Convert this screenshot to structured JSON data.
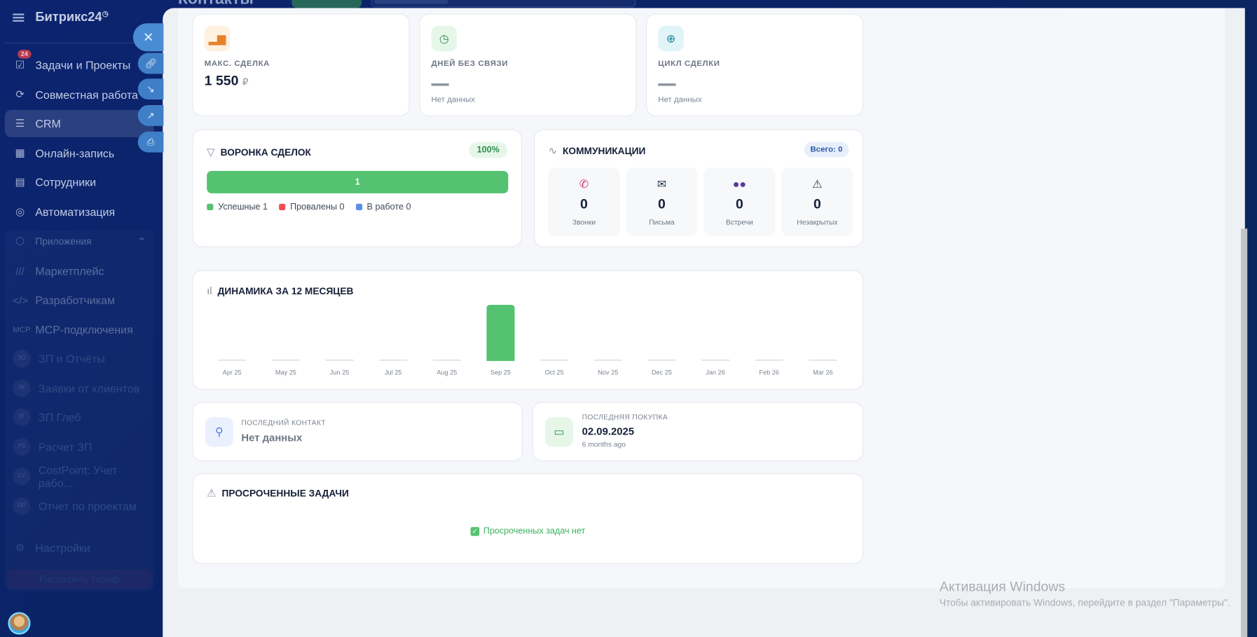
{
  "topbar": {
    "title": "Контакты"
  },
  "sidebar": {
    "logo": "Битрикс24",
    "items": [
      {
        "label": "Задачи и Проекты",
        "badge": "24"
      },
      {
        "label": "Совместная работа"
      },
      {
        "label": "CRM"
      },
      {
        "label": "Онлайн-запись"
      },
      {
        "label": "Сотрудники"
      },
      {
        "label": "Автоматизация"
      }
    ],
    "group": {
      "label": "Приложения",
      "items": [
        {
          "label": "Маркетплейс",
          "icon": "MI"
        },
        {
          "label": "Разработчикам",
          "icon": "</>"
        },
        {
          "label": "MCP-подключения",
          "icon": "MCP"
        },
        {
          "label": "ЗП и Отчёты",
          "icon": "ЗО"
        },
        {
          "label": "Заявки от клиентов",
          "icon": "ЗК"
        },
        {
          "label": "ЗП Глеб",
          "icon": "ЗГ"
        },
        {
          "label": "Расчет ЗП",
          "icon": "РЗ"
        },
        {
          "label": "CostPoint: Учет рабо...",
          "icon": "CУ"
        },
        {
          "label": "Отчет по проектам",
          "icon": "ОП"
        }
      ]
    },
    "settings": "Настройки",
    "tariff": "Расширить тариф"
  },
  "kpis": [
    {
      "label": "МАКС. СДЕЛКА",
      "value": "1 550",
      "unit": "₽"
    },
    {
      "label": "ДНЕЙ БЕЗ СВЯЗИ",
      "value": "—",
      "note": "Нет данных"
    },
    {
      "label": "ЦИКЛ СДЕЛКИ",
      "value": "—",
      "note": "Нет данных"
    }
  ],
  "funnel": {
    "title": "ВОРОНКА СДЕЛОК",
    "percent": "100%",
    "bar_value": "1",
    "success_fraction": 1.0,
    "legend": [
      {
        "label": "Успешные 1",
        "color": "#54c271"
      },
      {
        "label": "Провалены 0",
        "color": "#ef4d55"
      },
      {
        "label": "В работе 0",
        "color": "#5b8def"
      }
    ]
  },
  "comms": {
    "title": "КОММУНИКАЦИИ",
    "total": "Всего: 0",
    "tiles": [
      {
        "label": "Звонки",
        "value": "0",
        "icon": "📞"
      },
      {
        "label": "Письма",
        "value": "0",
        "icon": "✉"
      },
      {
        "label": "Встречи",
        "value": "0",
        "icon": "👥"
      },
      {
        "label": "Незакрытых",
        "value": "0",
        "icon": "⚠"
      }
    ]
  },
  "chart_data": {
    "type": "bar",
    "title": "ДИНАМИКА ЗА 12 МЕСЯЦЕВ",
    "categories": [
      "Apr 25",
      "May 25",
      "Jun 25",
      "Jul 25",
      "Aug 25",
      "Sep 25",
      "Oct 25",
      "Nov 25",
      "Dec 25",
      "Jan 26",
      "Feb 26",
      "Mar 26"
    ],
    "values": [
      0,
      0,
      0,
      0,
      0,
      1,
      0,
      0,
      0,
      0,
      0,
      0
    ],
    "color": "#54c271",
    "ylim": [
      0,
      1
    ],
    "xlabel": "",
    "ylabel": ""
  },
  "last_contact": {
    "label": "ПОСЛЕДНИЙ КОНТАКТ",
    "value": "Нет данных"
  },
  "last_purchase": {
    "label": "ПОСЛЕДНЯЯ ПОКУПКА",
    "value": "02.09.2025",
    "note": "6 months ago"
  },
  "overdue": {
    "title": "ПРОСРОЧЕННЫЕ ЗАДАЧИ",
    "empty": "Просроченных задач нет"
  },
  "watermark": {
    "title": "Активация Windows",
    "text": "Чтобы активировать Windows, перейдите в раздел \"Параметры\"."
  }
}
